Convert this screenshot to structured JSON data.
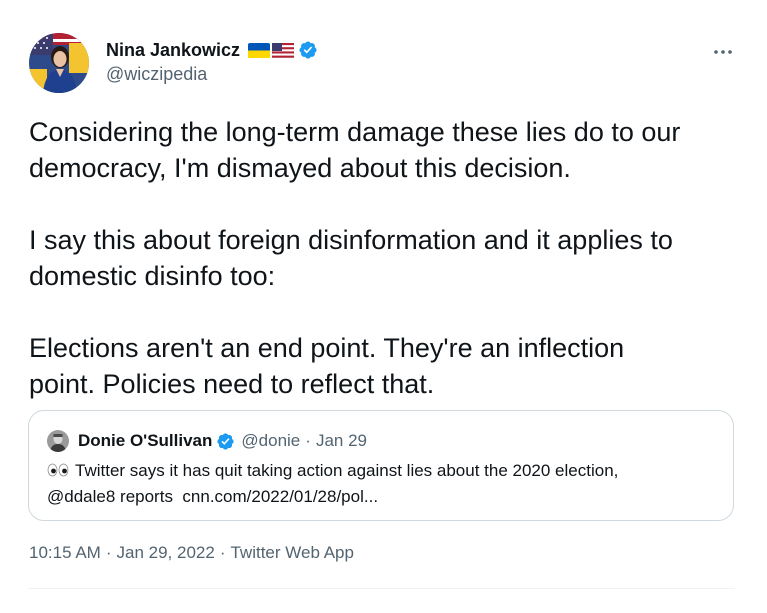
{
  "author": {
    "display_name": "Nina Jankowicz",
    "handle": "@wiczipedia",
    "verified": true,
    "flags": [
      "ukraine-flag",
      "us-flag"
    ],
    "avatar": "profile-photo"
  },
  "tweet": {
    "paragraphs": [
      [
        "Considering the long-term damage these lies do to our",
        "democracy, I'm dismayed about this decision."
      ],
      [
        "I say this about foreign disinformation and it applies to",
        "domestic disinfo too:"
      ],
      [
        "Elections aren't an end point. They're an inflection",
        "point. Policies need to reflect that."
      ]
    ],
    "time": "10:15 AM",
    "date": "Jan 29, 2022",
    "source": "Twitter Web App",
    "separator": "·"
  },
  "quoted": {
    "display_name": "Donie O'Sullivan",
    "handle": "@donie",
    "separator": "·",
    "date": "Jan 29",
    "verified": true,
    "emoji": "eyes-icon",
    "line1": "Twitter says it has quit taking action against lies about the 2020 election,",
    "mention": "@ddale8",
    "line2_mid": " reports  ",
    "link": "cnn.com/2022/01/28/pol..."
  },
  "icons": {
    "more": "more-options-icon",
    "verified": "verified-badge-icon"
  },
  "colors": {
    "text": "#0f1419",
    "secondary": "#536471",
    "verified": "#1d9bf0",
    "border": "#cfd9de"
  }
}
